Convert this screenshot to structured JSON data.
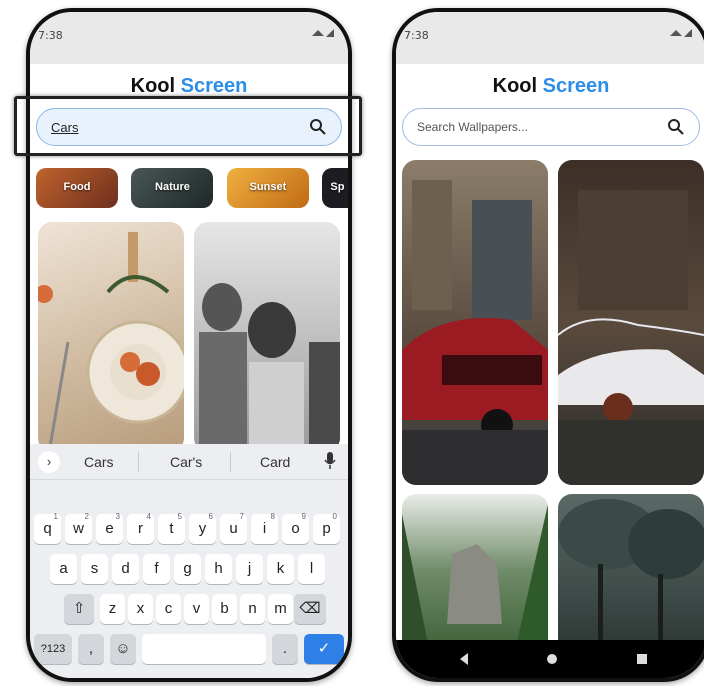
{
  "left_phone": {
    "status": {
      "time": "7:38",
      "status_icons": "gear-icon, dot, wifi-icon, signal-icon"
    },
    "brand": {
      "part1": "Kool",
      "part2": "Screen",
      "accent_color": "#2d8ee6"
    },
    "search": {
      "value": "Cars"
    },
    "categories": [
      {
        "label": "Food",
        "color": "#9a4a2a"
      },
      {
        "label": "Nature",
        "color": "#2f3a3a"
      },
      {
        "label": "Sunset",
        "color": "#d98a22"
      },
      {
        "label": "Sp",
        "color": "#1c1c22"
      }
    ],
    "tiles": [
      {
        "subject": "table-setting-photo",
        "color": "#d9c9b5"
      },
      {
        "subject": "friends-bw-photo",
        "color": "#9a9a9a"
      }
    ],
    "keyboard": {
      "suggestions": [
        "Cars",
        "Car's",
        "Card"
      ],
      "row1": [
        {
          "key": "q",
          "alt": "1"
        },
        {
          "key": "w",
          "alt": "2"
        },
        {
          "key": "e",
          "alt": "3"
        },
        {
          "key": "r",
          "alt": "4"
        },
        {
          "key": "t",
          "alt": "5"
        },
        {
          "key": "y",
          "alt": "6"
        },
        {
          "key": "u",
          "alt": "7"
        },
        {
          "key": "i",
          "alt": "8"
        },
        {
          "key": "o",
          "alt": "9"
        },
        {
          "key": "p",
          "alt": "0"
        }
      ],
      "row2": [
        "a",
        "s",
        "d",
        "f",
        "g",
        "h",
        "j",
        "k",
        "l"
      ],
      "row3": [
        "z",
        "x",
        "c",
        "v",
        "b",
        "n",
        "m"
      ],
      "symbols_label": "?123",
      "comma_label": ",",
      "period_label": ".",
      "accent_color": "#2f80e6"
    }
  },
  "right_phone": {
    "status": {
      "time": "7:38"
    },
    "brand": {
      "part1": "Kool",
      "part2": "Screen"
    },
    "search": {
      "placeholder": "Search Wallpapers..."
    },
    "tiles": [
      {
        "subject": "red-sports-car-photo",
        "color": "#7b2a2a"
      },
      {
        "subject": "white-muscle-car-photo",
        "color": "#4a3c34"
      },
      {
        "subject": "forest-cliff-photo",
        "color": "#4f6b4a"
      },
      {
        "subject": "dark-trees-photo",
        "color": "#2a3432"
      }
    ]
  }
}
